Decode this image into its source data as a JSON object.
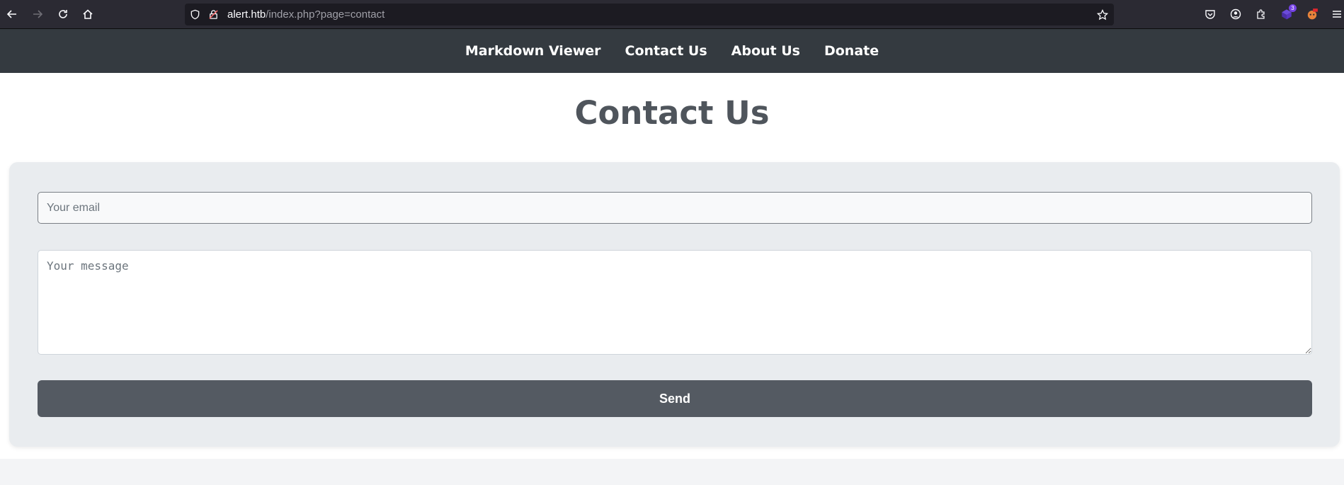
{
  "browser": {
    "url_host": "alert.htb",
    "url_path": "/index.php?page=contact",
    "extension_badge": "3",
    "accent_color": "#7542e5"
  },
  "nav": {
    "items": [
      {
        "label": "Markdown Viewer"
      },
      {
        "label": "Contact Us"
      },
      {
        "label": "About Us"
      },
      {
        "label": "Donate"
      }
    ]
  },
  "main": {
    "title": "Contact Us",
    "email_placeholder": "Your email",
    "message_placeholder": "Your message",
    "send_label": "Send"
  },
  "colors": {
    "navbar": "#343a40",
    "button": "#545a62",
    "card": "#e9ecef"
  }
}
